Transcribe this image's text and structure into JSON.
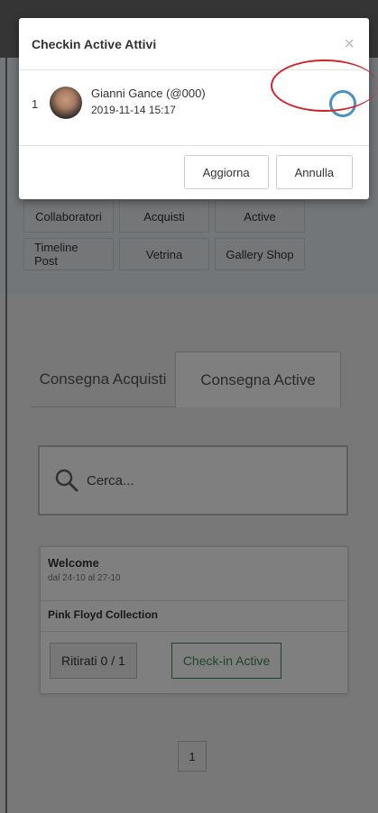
{
  "modal": {
    "title": "Checkin Active Attivi",
    "close": "×",
    "row_index": "1",
    "user_name": "Gianni Gance (@000)",
    "user_time": "2019-11-14 15:17",
    "btn_update": "Aggiorna",
    "btn_cancel": "Annulla"
  },
  "tiles": [
    "Collaboratori",
    "Acquisti",
    "Active",
    "Timeline Post",
    "Vetrina",
    "Gallery Shop"
  ],
  "tabs": {
    "purchases": "Consegna Acquisti",
    "active": "Consegna Active"
  },
  "search": {
    "placeholder": "Cerca..."
  },
  "card": {
    "title": "Welcome",
    "dates": "dal 24-10 al 27-10",
    "subtitle": "Pink Floyd Collection",
    "ritirati": "Ritirati 0 / 1",
    "checkin": "Check-in Active"
  },
  "pager": {
    "page": "1"
  },
  "colors": {
    "checkin_green": "#3b8a57",
    "circle_blue": "#4a90c2",
    "annotation_red": "#d0242c"
  }
}
